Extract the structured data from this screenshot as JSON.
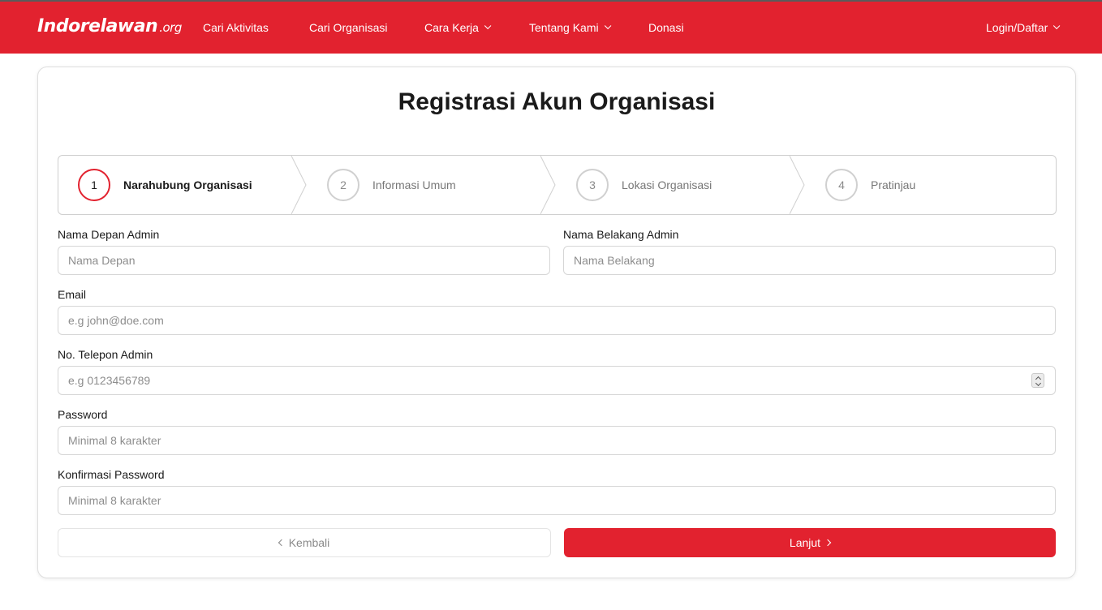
{
  "nav": {
    "logo_main": "Indorelawan",
    "logo_suffix": ".org",
    "items": [
      {
        "label": "Cari Aktivitas",
        "dropdown": false
      },
      {
        "label": "Cari Organisasi",
        "dropdown": false
      },
      {
        "label": "Cara Kerja",
        "dropdown": true
      },
      {
        "label": "Tentang Kami",
        "dropdown": true
      },
      {
        "label": "Donasi",
        "dropdown": false
      }
    ],
    "login_label": "Login/Daftar"
  },
  "page": {
    "title": "Registrasi Akun Organisasi"
  },
  "stepper": {
    "steps": [
      {
        "number": "1",
        "label": "Narahubung Organisasi",
        "active": true
      },
      {
        "number": "2",
        "label": "Informasi Umum",
        "active": false
      },
      {
        "number": "3",
        "label": "Lokasi Organisasi",
        "active": false
      },
      {
        "number": "4",
        "label": "Pratinjau",
        "active": false
      }
    ]
  },
  "form": {
    "first_name": {
      "label": "Nama Depan Admin",
      "placeholder": "Nama Depan",
      "value": ""
    },
    "last_name": {
      "label": "Nama Belakang Admin",
      "placeholder": "Nama Belakang",
      "value": ""
    },
    "email": {
      "label": "Email",
      "placeholder": "e.g john@doe.com",
      "value": ""
    },
    "phone": {
      "label": "No. Telepon Admin",
      "placeholder": "e.g 0123456789",
      "value": ""
    },
    "password": {
      "label": "Password",
      "placeholder": "Minimal 8 karakter",
      "value": ""
    },
    "confirm_password": {
      "label": "Konfirmasi Password",
      "placeholder": "Minimal 8 karakter",
      "value": ""
    }
  },
  "actions": {
    "back_label": "Kembali",
    "next_label": "Lanjut"
  },
  "colors": {
    "brand": "#e2222f",
    "border": "#d6d6d6",
    "muted_text": "#8d8d8d"
  }
}
